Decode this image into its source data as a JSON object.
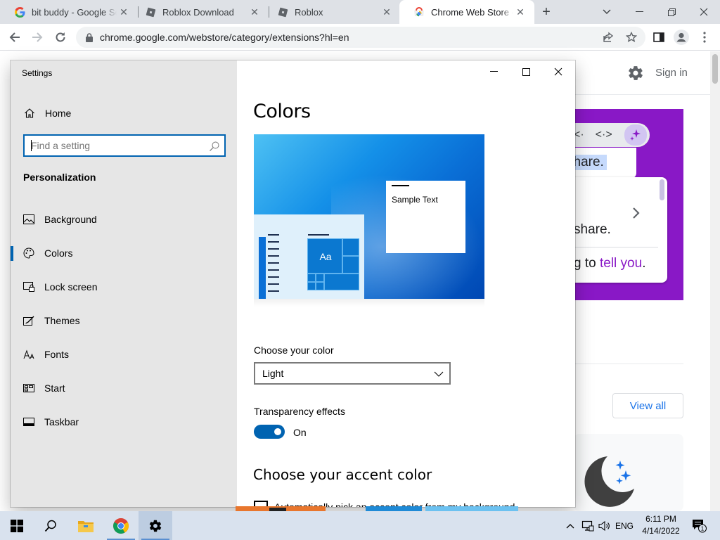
{
  "browser": {
    "tabs": [
      {
        "title": "bit buddy - Google Search",
        "icon": "google-g-icon",
        "active": false
      },
      {
        "title": "Roblox Download",
        "icon": "roblox-icon",
        "active": false
      },
      {
        "title": "Roblox",
        "icon": "roblox-icon",
        "active": false
      },
      {
        "title": "Chrome Web Store - Extensions",
        "icon": "chrome-web-store-icon",
        "active": true
      }
    ],
    "url": "chrome.google.com/webstore/category/extensions?hl=en"
  },
  "webpage": {
    "sign_in": "Sign in",
    "promo_highlight": "share.",
    "promo_line1": "share.",
    "promo_line2_start": "g to ",
    "promo_line2_accent": "tell you",
    "promo_line2_end": ".",
    "view_all": "View all",
    "accent_color": "#8918c6"
  },
  "settings": {
    "window_title": "Settings",
    "home": "Home",
    "search_placeholder": "Find a setting",
    "group": "Personalization",
    "nav": [
      {
        "label": "Background",
        "icon": "picture-icon",
        "selected": false
      },
      {
        "label": "Colors",
        "icon": "palette-icon",
        "selected": true
      },
      {
        "label": "Lock screen",
        "icon": "lock-screen-icon",
        "selected": false
      },
      {
        "label": "Themes",
        "icon": "brush-icon",
        "selected": false
      },
      {
        "label": "Fonts",
        "icon": "font-icon",
        "selected": false
      },
      {
        "label": "Start",
        "icon": "start-tiles-icon",
        "selected": false
      },
      {
        "label": "Taskbar",
        "icon": "taskbar-icon",
        "selected": false
      }
    ],
    "page_title": "Colors",
    "preview_sample_text": "Sample Text",
    "preview_tile_text": "Aa",
    "choose_color_label": "Choose your color",
    "choose_color_value": "Light",
    "transparency_label": "Transparency effects",
    "transparency_state": "On",
    "accent_title": "Choose your accent color",
    "auto_pick_label": "Automatically pick an accent color from my background",
    "accent_color": "#0063b1"
  },
  "taskbar": {
    "time": "6:11 PM",
    "date": "4/14/2022",
    "language": "ENG",
    "notification_count": "1"
  }
}
